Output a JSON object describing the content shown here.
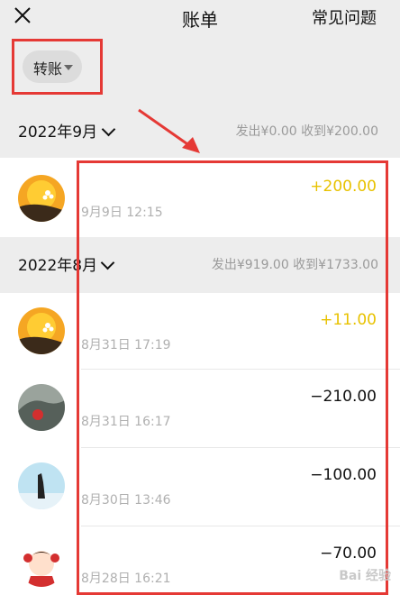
{
  "header": {
    "title": "账单",
    "help_label": "常见问题"
  },
  "filter": {
    "label": "转账"
  },
  "months": [
    {
      "label": "2022年9月",
      "summary": "发出¥0.00  收到¥200.00"
    },
    {
      "label": "2022年8月",
      "summary": "发出¥919.00  收到¥1733.00"
    }
  ],
  "transactions": [
    {
      "time": "9月9日 12:15",
      "amount": "+200.00",
      "amount_color": "#e8c200"
    },
    {
      "time": "8月31日 17:19",
      "amount": "+11.00",
      "amount_color": "#e8c200"
    },
    {
      "time": "8月31日 16:17",
      "amount": "−210.00",
      "amount_color": "#111111"
    },
    {
      "time": "8月30日 13:46",
      "amount": "−100.00",
      "amount_color": "#111111"
    },
    {
      "time": "8月28日 16:21",
      "amount": "−70.00",
      "amount_color": "#111111"
    }
  ],
  "watermark": "Bai 经验",
  "colors": {
    "highlight": "#e53935",
    "income": "#e8c200",
    "background": "#ededed"
  },
  "icons": [
    "close-icon",
    "chevron-down-icon",
    "caret-down-icon"
  ]
}
